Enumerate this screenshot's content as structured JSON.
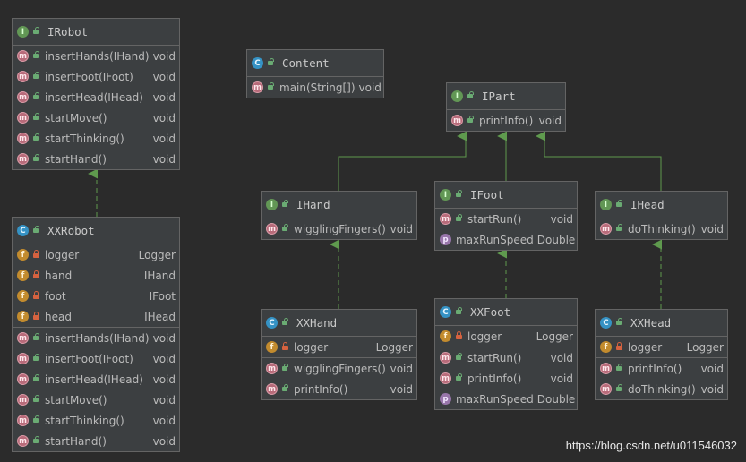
{
  "colors": {
    "background": "#2b2b2b",
    "node_fill": "#3c3f41",
    "node_border": "#646464",
    "edge": "#5f9a4e",
    "interface_badge": "#629755",
    "class_badge": "#3592c4",
    "method_badge": "#b86b7a",
    "field_badge": "#c28b2e",
    "property_badge": "#9876aa"
  },
  "icon_names": {
    "I": "interface-icon",
    "C": "class-icon",
    "m": "method-icon",
    "f": "field-icon",
    "p": "property-icon"
  },
  "nodes": {
    "irobot": {
      "kind": "I",
      "title": "IRobot",
      "sections": [
        [
          {
            "kind": "m",
            "vis": "public",
            "name": "insertHands(IHand)",
            "type": "void"
          },
          {
            "kind": "m",
            "vis": "public",
            "name": "insertFoot(IFoot)",
            "type": "void"
          },
          {
            "kind": "m",
            "vis": "public",
            "name": "insertHead(IHead)",
            "type": "void"
          },
          {
            "kind": "m",
            "vis": "public",
            "name": "startMove()",
            "type": "void"
          },
          {
            "kind": "m",
            "vis": "public",
            "name": "startThinking()",
            "type": "void"
          },
          {
            "kind": "m",
            "vis": "public",
            "name": "startHand()",
            "type": "void"
          }
        ]
      ]
    },
    "xxrobot": {
      "kind": "C",
      "title": "XXRobot",
      "sections": [
        [
          {
            "kind": "f",
            "vis": "private",
            "name": "logger",
            "type": "Logger"
          },
          {
            "kind": "f",
            "vis": "private",
            "name": "hand",
            "type": "IHand"
          },
          {
            "kind": "f",
            "vis": "private",
            "name": "foot",
            "type": "IFoot"
          },
          {
            "kind": "f",
            "vis": "private",
            "name": "head",
            "type": "IHead"
          }
        ],
        [
          {
            "kind": "m",
            "vis": "public",
            "name": "insertHands(IHand)",
            "type": "void"
          },
          {
            "kind": "m",
            "vis": "public",
            "name": "insertFoot(IFoot)",
            "type": "void"
          },
          {
            "kind": "m",
            "vis": "public",
            "name": "insertHead(IHead)",
            "type": "void"
          },
          {
            "kind": "m",
            "vis": "public",
            "name": "startMove()",
            "type": "void"
          },
          {
            "kind": "m",
            "vis": "public",
            "name": "startThinking()",
            "type": "void"
          },
          {
            "kind": "m",
            "vis": "public",
            "name": "startHand()",
            "type": "void"
          }
        ]
      ]
    },
    "content": {
      "kind": "C",
      "title": "Content",
      "sections": [
        [
          {
            "kind": "m",
            "vis": "public",
            "name": "main(String[])",
            "type": "void"
          }
        ]
      ]
    },
    "ipart": {
      "kind": "I",
      "title": "IPart",
      "sections": [
        [
          {
            "kind": "m",
            "vis": "public",
            "name": "printInfo()",
            "type": "void"
          }
        ]
      ]
    },
    "ihand": {
      "kind": "I",
      "title": "IHand",
      "sections": [
        [
          {
            "kind": "m",
            "vis": "public",
            "name": "wigglingFingers()",
            "type": "void"
          }
        ]
      ]
    },
    "ifoot": {
      "kind": "I",
      "title": "IFoot",
      "sections": [
        [
          {
            "kind": "m",
            "vis": "public",
            "name": "startRun()",
            "type": "void"
          },
          {
            "kind": "p",
            "vis": "none",
            "name": "maxRunSpeed",
            "type": "Double"
          }
        ]
      ]
    },
    "ihead": {
      "kind": "I",
      "title": "IHead",
      "sections": [
        [
          {
            "kind": "m",
            "vis": "public",
            "name": "doThinking()",
            "type": "void"
          }
        ]
      ]
    },
    "xxhand": {
      "kind": "C",
      "title": "XXHand",
      "sections": [
        [
          {
            "kind": "f",
            "vis": "private",
            "name": "logger",
            "type": "Logger"
          }
        ],
        [
          {
            "kind": "m",
            "vis": "public",
            "name": "wigglingFingers()",
            "type": "void"
          },
          {
            "kind": "m",
            "vis": "public",
            "name": "printInfo()",
            "type": "void"
          }
        ]
      ]
    },
    "xxfoot": {
      "kind": "C",
      "title": "XXFoot",
      "sections": [
        [
          {
            "kind": "f",
            "vis": "private",
            "name": "logger",
            "type": "Logger"
          }
        ],
        [
          {
            "kind": "m",
            "vis": "public",
            "name": "startRun()",
            "type": "void"
          },
          {
            "kind": "m",
            "vis": "public",
            "name": "printInfo()",
            "type": "void"
          },
          {
            "kind": "p",
            "vis": "none",
            "name": "maxRunSpeed",
            "type": "Double"
          }
        ]
      ]
    },
    "xxhead": {
      "kind": "C",
      "title": "XXHead",
      "sections": [
        [
          {
            "kind": "f",
            "vis": "private",
            "name": "logger",
            "type": "Logger"
          }
        ],
        [
          {
            "kind": "m",
            "vis": "public",
            "name": "printInfo()",
            "type": "void"
          },
          {
            "kind": "m",
            "vis": "public",
            "name": "doThinking()",
            "type": "void"
          }
        ]
      ]
    }
  },
  "watermark": "https://blog.csdn.net/u011546032"
}
